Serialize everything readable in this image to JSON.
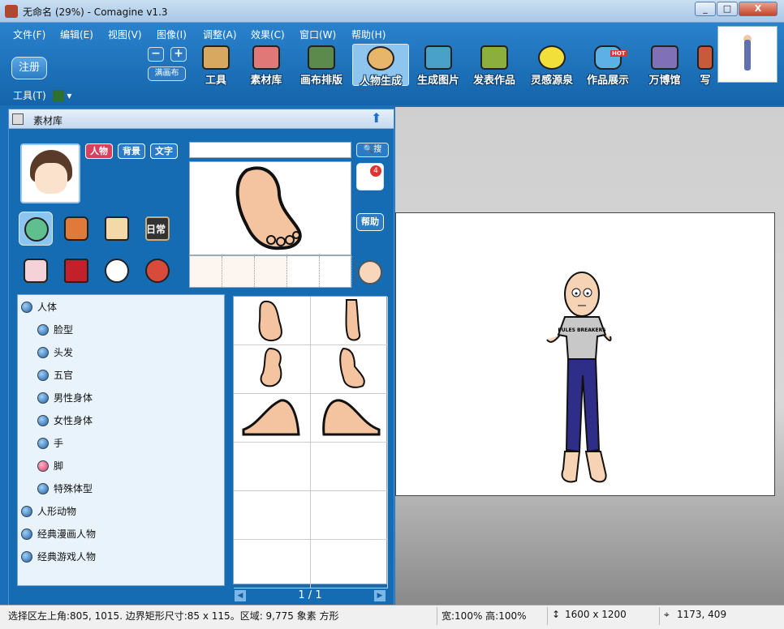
{
  "window": {
    "title": "无命名 (29%) - Comagine v1.3",
    "controls": [
      "_",
      "□",
      "X"
    ]
  },
  "menu": [
    "文件(F)",
    "编辑(E)",
    "视图(V)",
    "图像(I)",
    "调整(A)",
    "效果(C)",
    "窗口(W)",
    "帮助(H)"
  ],
  "toolbar": {
    "register": "注册",
    "zoom_out": "−",
    "zoom_in": "+",
    "fit": "满画布",
    "buttons": [
      {
        "label": "工具",
        "icon": "tools-icon"
      },
      {
        "label": "素材库",
        "icon": "library-icon"
      },
      {
        "label": "画布排版",
        "icon": "layout-icon"
      },
      {
        "label": "人物生成",
        "icon": "character-icon"
      },
      {
        "label": "生成图片",
        "icon": "export-image-icon"
      },
      {
        "label": "发表作品",
        "icon": "publish-icon"
      },
      {
        "label": "灵感源泉",
        "icon": "idea-icon"
      },
      {
        "label": "作品展示",
        "icon": "showcase-icon"
      },
      {
        "label": "万博馆",
        "icon": "museum-icon"
      },
      {
        "label": "写",
        "icon": "write-icon"
      }
    ],
    "hot_badge": "HOT",
    "active": "人物生成"
  },
  "subtoolbar": {
    "label": "工具(T)"
  },
  "panel": {
    "title": "素材库",
    "tabs": [
      "人物",
      "背景",
      "文字"
    ],
    "search_button": "搜",
    "badge": "4",
    "help": "帮助",
    "categories": [
      "character-head-icon",
      "clothes-icon",
      "house-icon",
      "daily-sign-icon",
      "cake-icon",
      "mystery-box-icon",
      "cat-icon",
      "umbrella-icon"
    ],
    "daily_label": "日常",
    "tree": [
      {
        "label": "人体",
        "level": 0
      },
      {
        "label": "脸型",
        "level": 1
      },
      {
        "label": "头发",
        "level": 1
      },
      {
        "label": "五官",
        "level": 1
      },
      {
        "label": "男性身体",
        "level": 1
      },
      {
        "label": "女性身体",
        "level": 1
      },
      {
        "label": "手",
        "level": 1
      },
      {
        "label": "脚",
        "level": 1,
        "selected": true
      },
      {
        "label": "特殊体型",
        "level": 1
      },
      {
        "label": "人形动物",
        "level": 0
      },
      {
        "label": "经典漫画人物",
        "level": 0
      },
      {
        "label": "经典游戏人物",
        "level": 0
      }
    ],
    "pager": "1 / 1"
  },
  "canvas": {
    "shirt_text": "PULES BREAKERS"
  },
  "status": {
    "selection": "选择区左上角:805, 1015. 边界矩形尺寸:85 x 115。区域: 9,775 象素 方形",
    "zoom": "宽:100%  高:100%",
    "size": "1600 x 1200",
    "cursor": "1173, 409"
  }
}
